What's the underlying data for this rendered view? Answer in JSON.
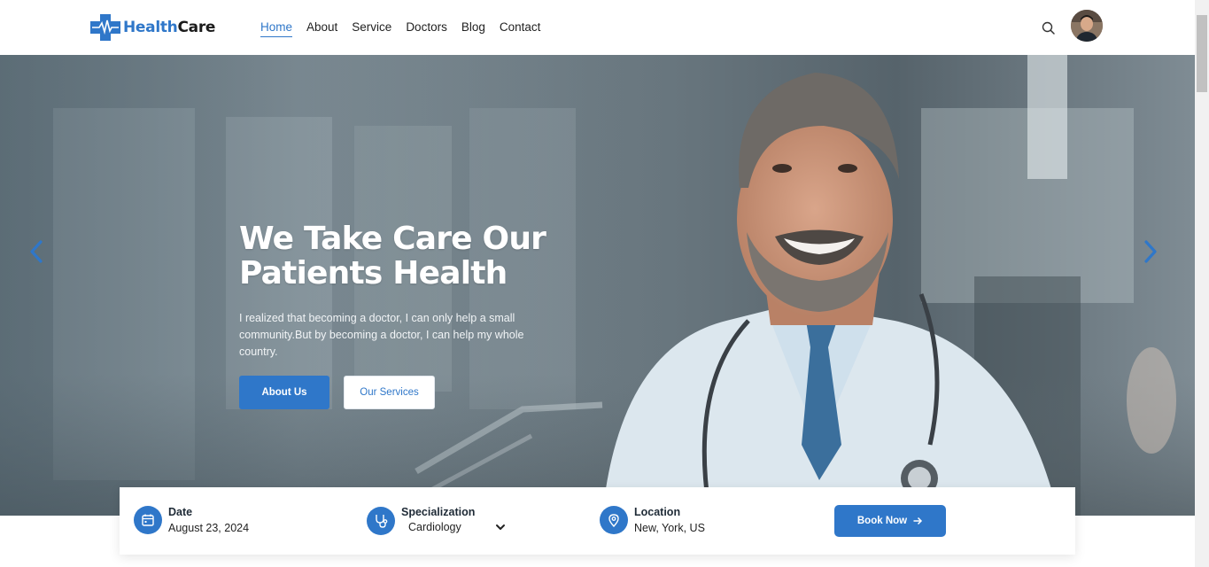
{
  "brand": {
    "name_part1": "Health",
    "name_part2": "Care"
  },
  "nav": {
    "items": [
      {
        "label": "Home",
        "active": true
      },
      {
        "label": "About",
        "active": false
      },
      {
        "label": "Service",
        "active": false
      },
      {
        "label": "Doctors",
        "active": false
      },
      {
        "label": "Blog",
        "active": false
      },
      {
        "label": "Contact",
        "active": false
      }
    ]
  },
  "header_icons": [
    "search-icon",
    "avatar"
  ],
  "hero": {
    "title_line1": "We Take Care Our",
    "title_line2": "Patients Health",
    "description": "I realized that becoming a doctor, I can only help a small community.But by becoming a doctor, I can help my whole country.",
    "primary_button": "About Us",
    "secondary_button": "Our Services"
  },
  "booking": {
    "date_label": "Date",
    "date_value": "August 23, 2024",
    "spec_label": "Specialization",
    "spec_value": "Cardiology",
    "location_label": "Location",
    "location_value": "New, York, US",
    "book_button": "Book Now"
  },
  "colors": {
    "accent": "#2f77c9",
    "text_dark": "#1e2a36"
  }
}
